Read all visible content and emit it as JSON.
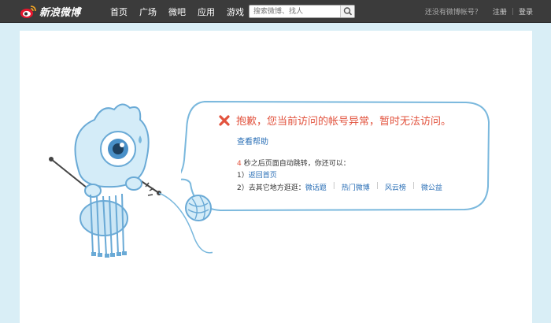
{
  "topbar": {
    "logo_text": "新浪微博",
    "nav": [
      "首页",
      "广场",
      "微吧",
      "应用",
      "游戏"
    ],
    "search_placeholder": "搜索微博、找人",
    "no_account_text": "还没有微博帐号？",
    "register_label": "注册",
    "separator": "|",
    "login_label": "登录"
  },
  "error": {
    "message": "抱歉，您当前访问的帐号异常，暂时无法访问。",
    "help_label": "查看帮助",
    "countdown_number": "4",
    "countdown_text": "秒之后页面自动跳转，你还可以：",
    "option1_prefix": "1）",
    "option1_link": "返回首页",
    "option2_prefix": "2）去其它地方逛逛：",
    "option2_links": [
      "微话题",
      "热门微博",
      "风云榜",
      "微公益"
    ]
  },
  "colors": {
    "topbar_bg": "#3b3b3b",
    "page_bg": "#d9eef6",
    "error_red": "#e2533e",
    "link_blue": "#2a6fb6"
  }
}
